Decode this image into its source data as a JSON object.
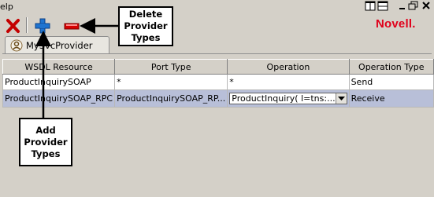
{
  "menu": {
    "fragment": "elp"
  },
  "toolbar": {
    "delete_icon": "red-x-icon",
    "add_icon": "blue-plus-icon",
    "remove_icon": "red-minus-icon"
  },
  "brand": {
    "name": "Novell.",
    "color": "#e0001b"
  },
  "tab": {
    "label": "MySvcProvider",
    "icon": "provider-person-icon"
  },
  "table": {
    "columns": [
      "WSDL Resource",
      "Port Type",
      "Operation",
      "Operation Type"
    ],
    "rows": [
      {
        "wsdl_resource": "ProductInquirySOAP",
        "port_type": "*",
        "operation": "*",
        "operation_type": "Send",
        "selected": false
      },
      {
        "wsdl_resource": "ProductInquirySOAP_RPC",
        "port_type": "ProductInquirySOAP_RP...",
        "operation": "ProductInquiry( l=tns:...",
        "operation_type": "Receive",
        "selected": true
      }
    ]
  },
  "callouts": {
    "delete": "Delete Provider Types",
    "add": "Add Provider Types"
  }
}
